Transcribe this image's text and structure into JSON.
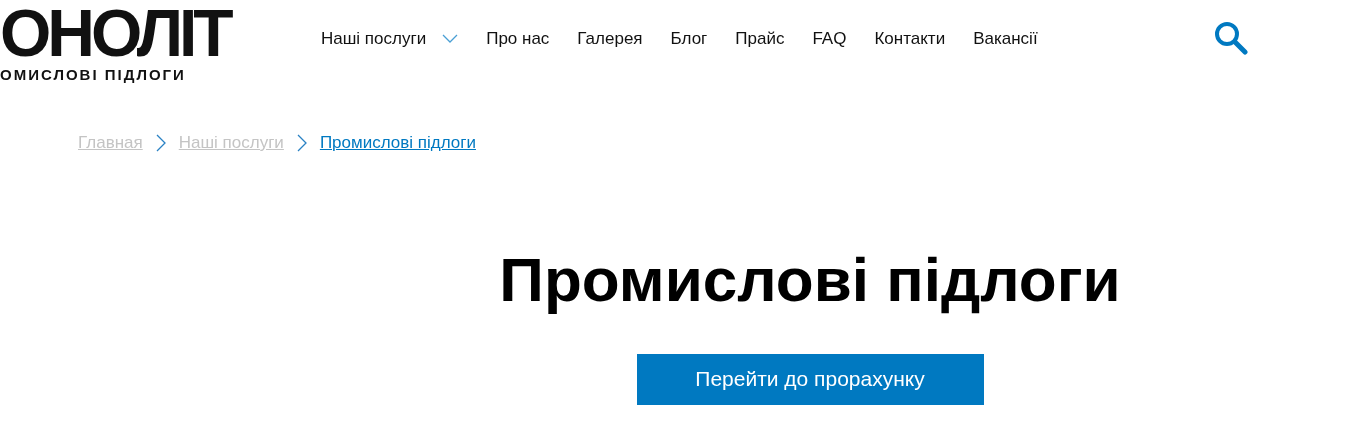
{
  "logo": {
    "title": "ОНОЛІТ",
    "subtitle": "ОМИСЛОВІ ПІДЛОГИ"
  },
  "nav": [
    {
      "label": "Наші послуги",
      "has_dropdown": true
    },
    {
      "label": "Про нас",
      "has_dropdown": false
    },
    {
      "label": "Галерея",
      "has_dropdown": false
    },
    {
      "label": "Блог",
      "has_dropdown": false
    },
    {
      "label": "Прайс",
      "has_dropdown": false
    },
    {
      "label": "FAQ",
      "has_dropdown": false
    },
    {
      "label": "Контакти",
      "has_dropdown": false
    },
    {
      "label": "Вакансії",
      "has_dropdown": false
    }
  ],
  "breadcrumbs": [
    {
      "label": "Главная",
      "selected": false
    },
    {
      "label": "Наші послуги",
      "selected": false
    },
    {
      "label": "Промислові підлоги",
      "selected": true
    }
  ],
  "heading": "Промислові підлоги",
  "cta_button": "Перейти до прорахунку"
}
